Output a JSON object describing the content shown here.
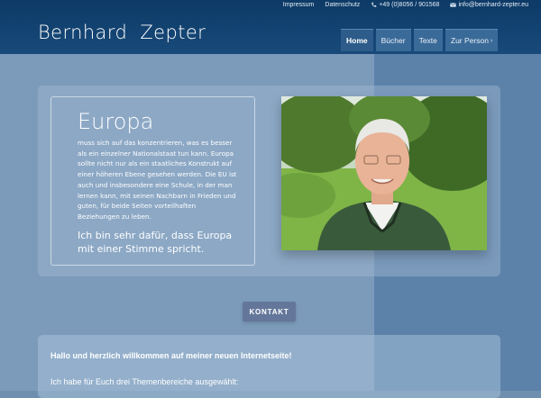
{
  "topbar": {
    "impressum": "Impressum",
    "datenschutz": "Datenschutz",
    "phone": "+49 (0)8056 / 901568",
    "email": "info@bernhard-zepter.eu"
  },
  "site": {
    "logo": "Bernhard  Zepter"
  },
  "nav": {
    "items": [
      {
        "label": "Home",
        "active": true
      },
      {
        "label": "Bücher"
      },
      {
        "label": "Texte"
      },
      {
        "label": "Zur Person"
      }
    ]
  },
  "hero": {
    "title": "Europa",
    "body": "muss sich auf das konzentrieren, was es besser als ein einzelner Nationalstaat tun kann. Europa sollte nicht nur als ein staatliches Konstrukt auf einer höheren Ebene gesehen werden. Die EU ist auch und insbesondere eine Schule, in der man lernen kann, mit seinen Nachbarn in Frieden und guten, für beide Seiten vorteilhaften Beziehungen zu leben.",
    "quote": "Ich bin sehr dafür, dass Europa mit einer Stimme spricht."
  },
  "cta": {
    "kontakt": "KONTAKT"
  },
  "welcome": {
    "heading": "Hallo und herzlich willkommen auf meiner neuen Internetseite!",
    "text": "Ich habe für Euch drei Themenbereiche ausgewählt:"
  },
  "icons": {
    "phone": "phone-icon",
    "email": "envelope-icon",
    "nav_more": "chevron-right-icon"
  },
  "colors": {
    "header": "#0d3a66",
    "nav_active": "#2d5c8a",
    "button": "#64779a"
  }
}
